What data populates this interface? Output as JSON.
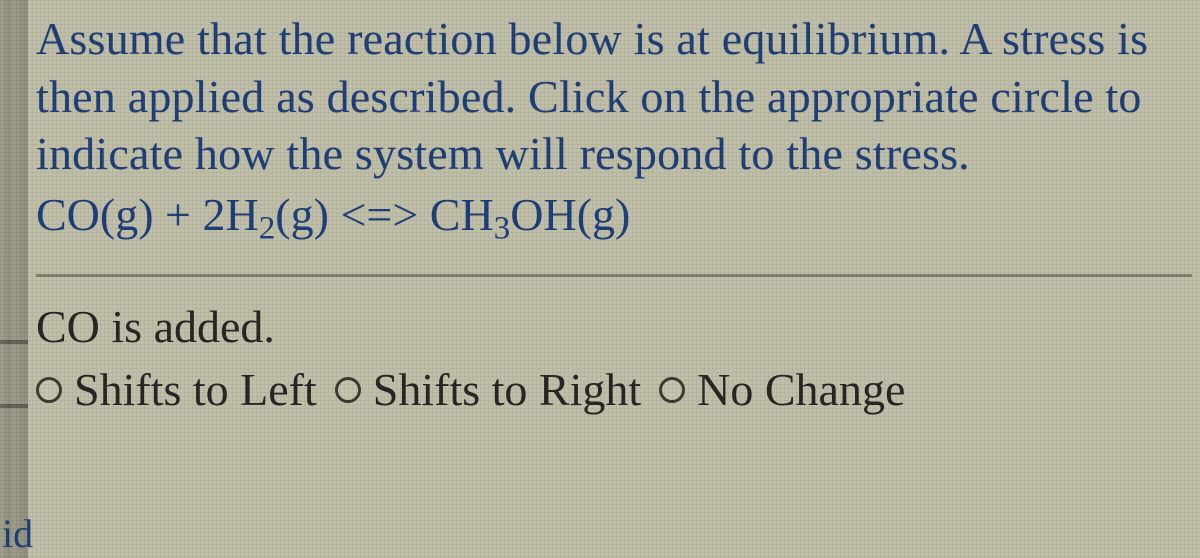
{
  "question": {
    "prompt": "Assume that the reaction below is at equilibrium. A stress is then applied as described. Click on the appropriate circle to indicate how the system will respond to the stress.",
    "equation": {
      "left1_species": "CO",
      "left1_phase": "(g)",
      "plus": " + ",
      "left2_coeff": "2",
      "left2_species_base": "H",
      "left2_species_sub": "2",
      "left2_phase": "(g)",
      "arrow": " <=> ",
      "right_species_base": "CH",
      "right_species_sub": "3",
      "right_species_tail": "OH",
      "right_phase": "(g)"
    }
  },
  "stress": {
    "description": "CO is added."
  },
  "options": [
    {
      "label": "Shifts to Left"
    },
    {
      "label": "Shifts to Right"
    },
    {
      "label": "No Change"
    }
  ],
  "corner_fragment": "id"
}
